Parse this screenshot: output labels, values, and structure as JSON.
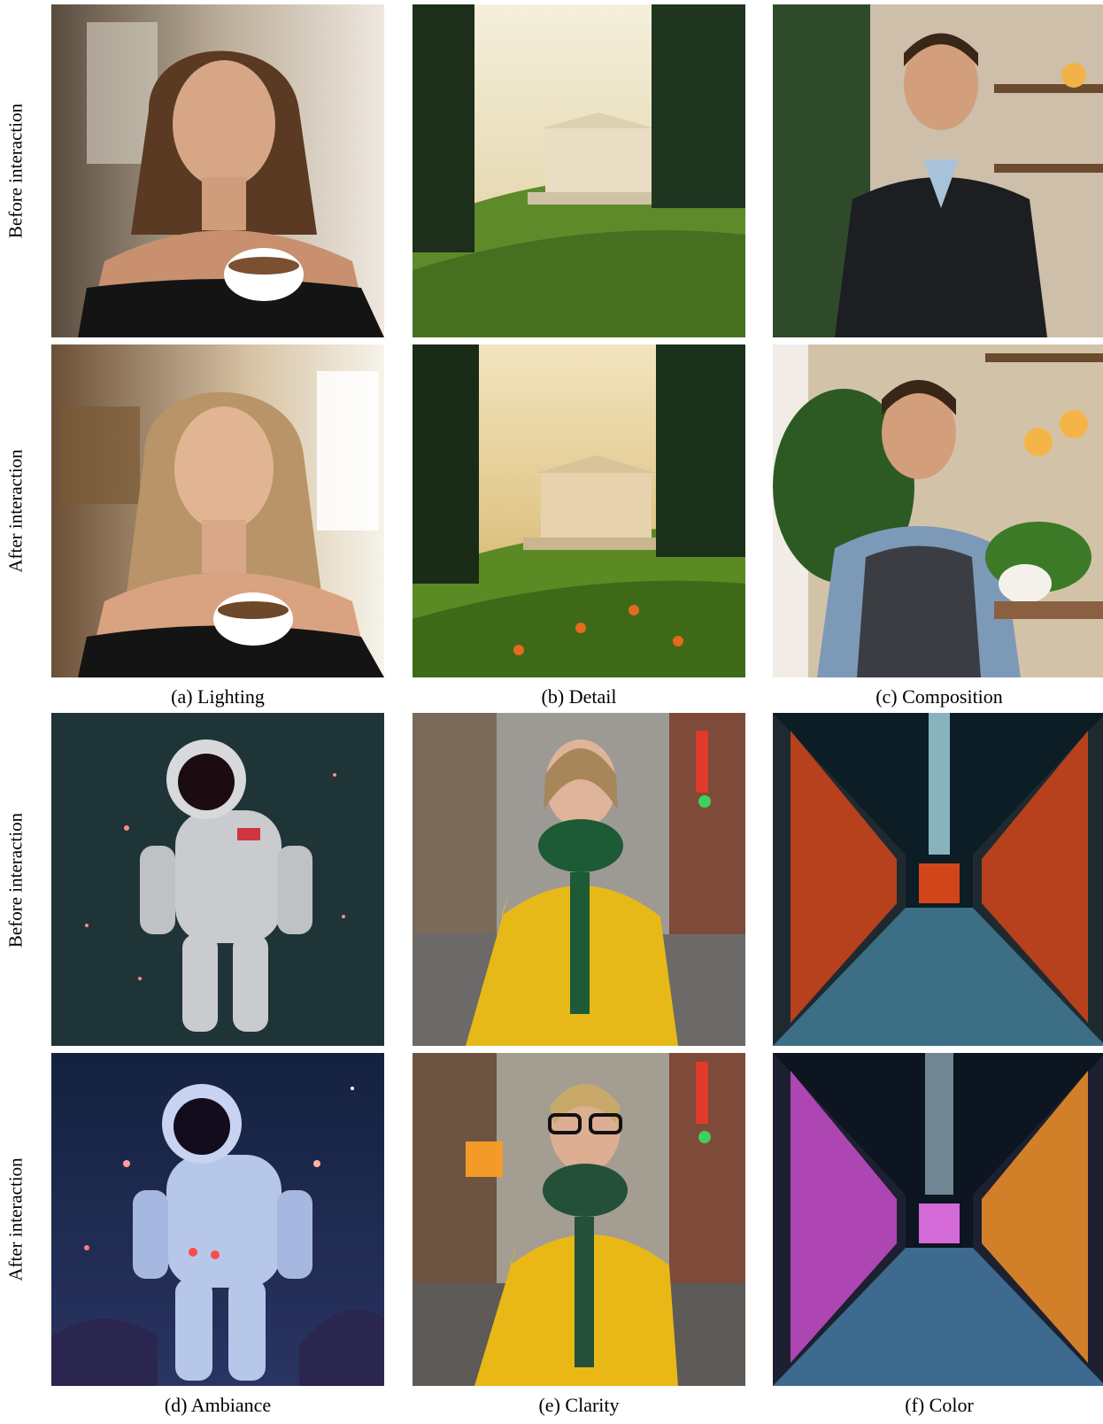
{
  "row_labels": {
    "before": "Before interaction",
    "after": "After interaction"
  },
  "captions": {
    "a": "(a) Lighting",
    "b": "(b) Detail",
    "c": "(c) Composition",
    "d": "(d) Ambiance",
    "e": "(e) Clarity",
    "f": "(f) Color"
  }
}
